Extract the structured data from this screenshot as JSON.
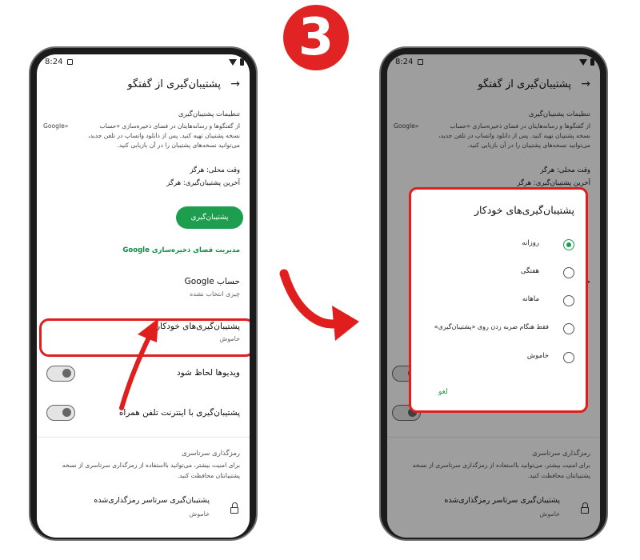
{
  "step_badge": "3",
  "colors": {
    "accent_green": "#1d9e4f",
    "highlight_red": "#e01e1e",
    "badge_red": "#e22323"
  },
  "status_bar": {
    "time": "8:24"
  },
  "header": {
    "title": "پشتیبان‌گیری از گفتگو",
    "back_icon": "arrow-right-icon"
  },
  "backup_settings": {
    "heading": "تنظیمات پشتیبان‌گیری",
    "desc_line1": "از گفتگوها و رسانه‌هایتان در فضای ذخیره‌سازی «حساب",
    "desc_line2_google": "Google»",
    "desc_line3": "نسخه پشتیبان تهیه کنید. پس از دانلود واتساپ در تلفن جدید،",
    "desc_line4": "می‌توانید نسخه‌های پشتیبان را در آن بازیابی کنید.",
    "local_time": "وقت محلی: هرگز",
    "last_backup": "آخرین پشتیبان‌گیری: هرگز",
    "backup_button": "پشتیبان‌گیری",
    "manage_link_prefix": "مدیریت فضای ذخیره‌سازی",
    "manage_link_google": "Google"
  },
  "google_account": {
    "title_prefix": "حساب",
    "title_google": "Google",
    "value": "چیزی انتخاب نشده"
  },
  "auto_backup": {
    "title": "پشتیبان‌گیری‌های خودکار",
    "value": "خاموش"
  },
  "include_videos": {
    "label": "ویدیوها لحاظ شود",
    "enabled": false
  },
  "cellular_backup": {
    "label": "پشتیبان‌گیری با اینترنت تلفن همراه",
    "enabled": false
  },
  "encryption": {
    "heading": "رمزگذاری سرتاسری",
    "desc_line1": "برای امنیت بیشتر، می‌توانید بااستفاده از رمزگذاری سرتاسری  از نسخه",
    "desc_line2": "پشتیبانتان محافظت کنید.",
    "item_title": "پشتیبان‌گیری سرتاسر رمزگذاری‌شده",
    "item_value": "خاموش",
    "icon": "lock-icon"
  },
  "dialog": {
    "title": "پشتیبان‌گیری‌های خودکار",
    "options": [
      "روزانه",
      "هفتگی",
      "ماهانه",
      "فقط هنگام ضربه زدن روی «پشتیبان‌گیری»",
      "خاموش"
    ],
    "selected": "روزانه",
    "cancel": "لغو"
  }
}
